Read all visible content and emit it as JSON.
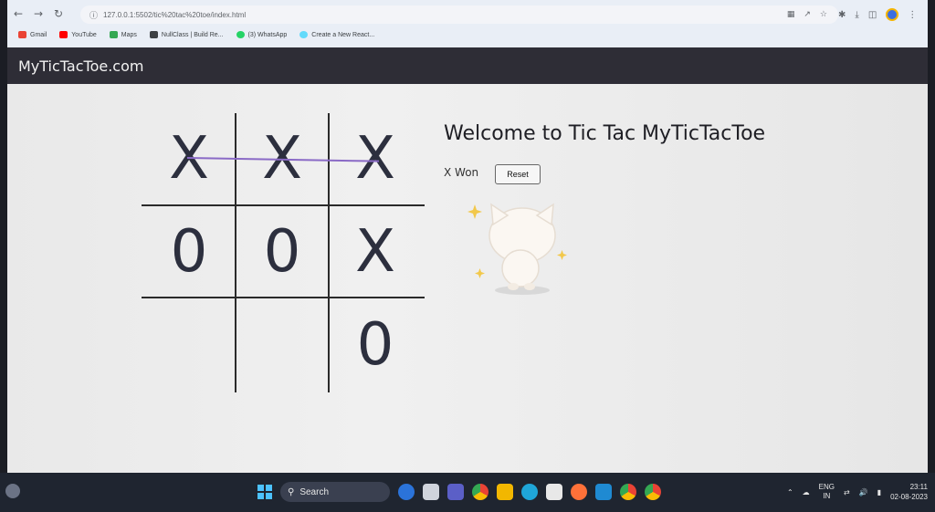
{
  "browser": {
    "url": "127.0.0.1:5502/tic%20tac%20toe/index.html",
    "bookmarks": [
      {
        "label": "Gmail",
        "icon": "gmail-icon",
        "color": "#ea4335"
      },
      {
        "label": "YouTube",
        "icon": "youtube-icon",
        "color": "#ff0000"
      },
      {
        "label": "Maps",
        "icon": "maps-icon",
        "color": "#34a853"
      },
      {
        "label": "NullClass | Build Re...",
        "icon": "nullclass-icon",
        "color": "#3c4043"
      },
      {
        "label": "(3) WhatsApp",
        "icon": "whatsapp-icon",
        "color": "#25d366"
      },
      {
        "label": "Create a New React...",
        "icon": "react-icon",
        "color": "#61dafb"
      }
    ]
  },
  "site": {
    "brand": "MyTicTacToe.com"
  },
  "game": {
    "title": "Welcome to Tic Tac MyTicTacToe",
    "status": "X Won",
    "reset_label": "Reset",
    "cells": [
      "X",
      "X",
      "X",
      "0",
      "0",
      "X",
      "",
      "",
      "0"
    ]
  },
  "taskbar": {
    "search_label": "Search",
    "language": "ENG",
    "region": "IN",
    "time": "23:11",
    "date": "02-08-2023"
  }
}
